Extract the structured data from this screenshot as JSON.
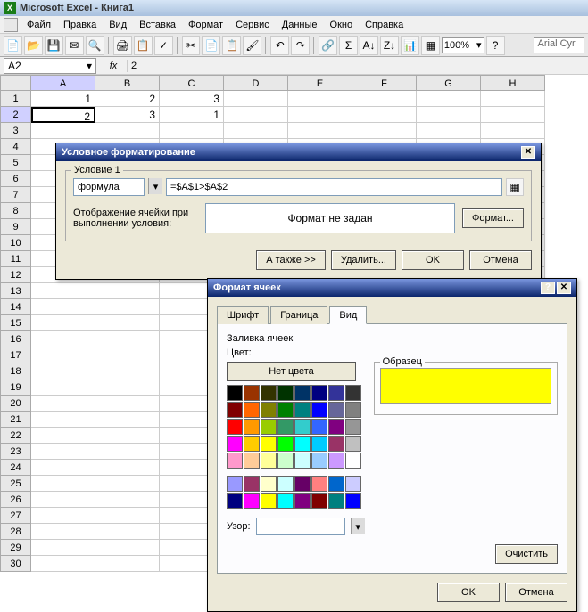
{
  "app": {
    "title": "Microsoft Excel - Книга1"
  },
  "menu": [
    "Файл",
    "Правка",
    "Вид",
    "Вставка",
    "Формат",
    "Сервис",
    "Данные",
    "Окно",
    "Справка"
  ],
  "toolbar": {
    "zoom": "100%",
    "font": "Arial Cyr"
  },
  "namebox": "A2",
  "fx": "fx",
  "formula": "2",
  "columns": [
    "A",
    "B",
    "C",
    "D",
    "E",
    "F",
    "G",
    "H"
  ],
  "row_count": 30,
  "selected_col": "A",
  "selected_row": 2,
  "cells": {
    "A1": "1",
    "B1": "2",
    "C1": "3",
    "A2": "2",
    "B2": "3",
    "C2": "1"
  },
  "cf": {
    "title": "Условное форматирование",
    "condition_label": "Условие 1",
    "type": "формула",
    "formula": "=$A$1>$A$2",
    "display_label": "Отображение ячейки при выполнении условия:",
    "preview": "Формат не задан",
    "format_btn": "Формат...",
    "also_btn": "А также >>",
    "delete_btn": "Удалить...",
    "ok_btn": "OK",
    "cancel_btn": "Отмена"
  },
  "fmt": {
    "title": "Формат ячеек",
    "tabs": [
      "Шрифт",
      "Граница",
      "Вид"
    ],
    "active_tab": "Вид",
    "fill_label": "Заливка ячеек",
    "color_label": "Цвет:",
    "no_color": "Нет цвета",
    "pattern_label": "Узор:",
    "sample_label": "Образец",
    "sample_color": "#ffff00",
    "clear_btn": "Очистить",
    "ok_btn": "OK",
    "cancel_btn": "Отмена",
    "palette_main": [
      "#000000",
      "#993300",
      "#333300",
      "#003300",
      "#003366",
      "#000080",
      "#333399",
      "#333333",
      "#800000",
      "#ff6600",
      "#808000",
      "#008000",
      "#008080",
      "#0000ff",
      "#666699",
      "#808080",
      "#ff0000",
      "#ff9900",
      "#99cc00",
      "#339966",
      "#33cccc",
      "#3366ff",
      "#800080",
      "#969696",
      "#ff00ff",
      "#ffcc00",
      "#ffff00",
      "#00ff00",
      "#00ffff",
      "#00ccff",
      "#993366",
      "#c0c0c0",
      "#ff99cc",
      "#ffcc99",
      "#ffff99",
      "#ccffcc",
      "#ccffff",
      "#99ccff",
      "#cc99ff",
      "#ffffff"
    ],
    "palette_extra": [
      "#9999ff",
      "#993366",
      "#ffffcc",
      "#ccffff",
      "#660066",
      "#ff8080",
      "#0066cc",
      "#ccccff",
      "#000080",
      "#ff00ff",
      "#ffff00",
      "#00ffff",
      "#800080",
      "#800000",
      "#008080",
      "#0000ff"
    ]
  }
}
